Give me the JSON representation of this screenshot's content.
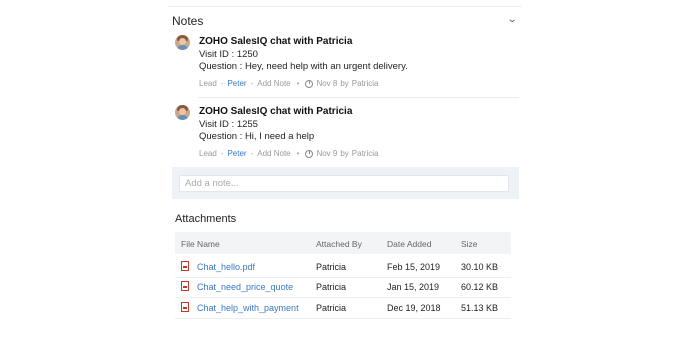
{
  "notes": {
    "heading": "Notes",
    "collapse_icon": "chevron-down-icon",
    "items": [
      {
        "title": "ZOHO SalesIQ chat with Patricia",
        "line1": "Visit ID : 1250",
        "line2": "Question : Hey, need help with an urgent delivery.",
        "module": "Lead",
        "owner": "Peter",
        "add_note": "Add Note",
        "date": "Nov 8",
        "by": "by",
        "author": "Patricia"
      },
      {
        "title": "ZOHO SalesIQ chat with Patricia",
        "line1": "Visit ID : 1255",
        "line2": "Question : Hi, I need a help",
        "module": "Lead",
        "owner": "Peter",
        "add_note": "Add Note",
        "date": "Nov 9",
        "by": "by",
        "author": "Patricia"
      }
    ],
    "add_note_placeholder": "Add a note..."
  },
  "attachments": {
    "heading": "Attachments",
    "columns": [
      "File Name",
      "Attached By",
      "Date Added",
      "Size"
    ],
    "rows": [
      {
        "file": "Chat_hello.pdf",
        "by": "Patricia",
        "date": "Feb 15, 2019",
        "size": "30.10 KB"
      },
      {
        "file": "Chat_need_price_quote",
        "by": "Patricia",
        "date": "Jan 15, 2019",
        "size": "60.12 KB"
      },
      {
        "file": "Chat_help_with_payment",
        "by": "Patricia",
        "date": "Dec 19, 2018",
        "size": "51.13 KB"
      }
    ]
  },
  "colors": {
    "link": "#3a78c4",
    "add_note_bg": "#eef1f5",
    "table_header_bg": "#f3f4f6"
  }
}
